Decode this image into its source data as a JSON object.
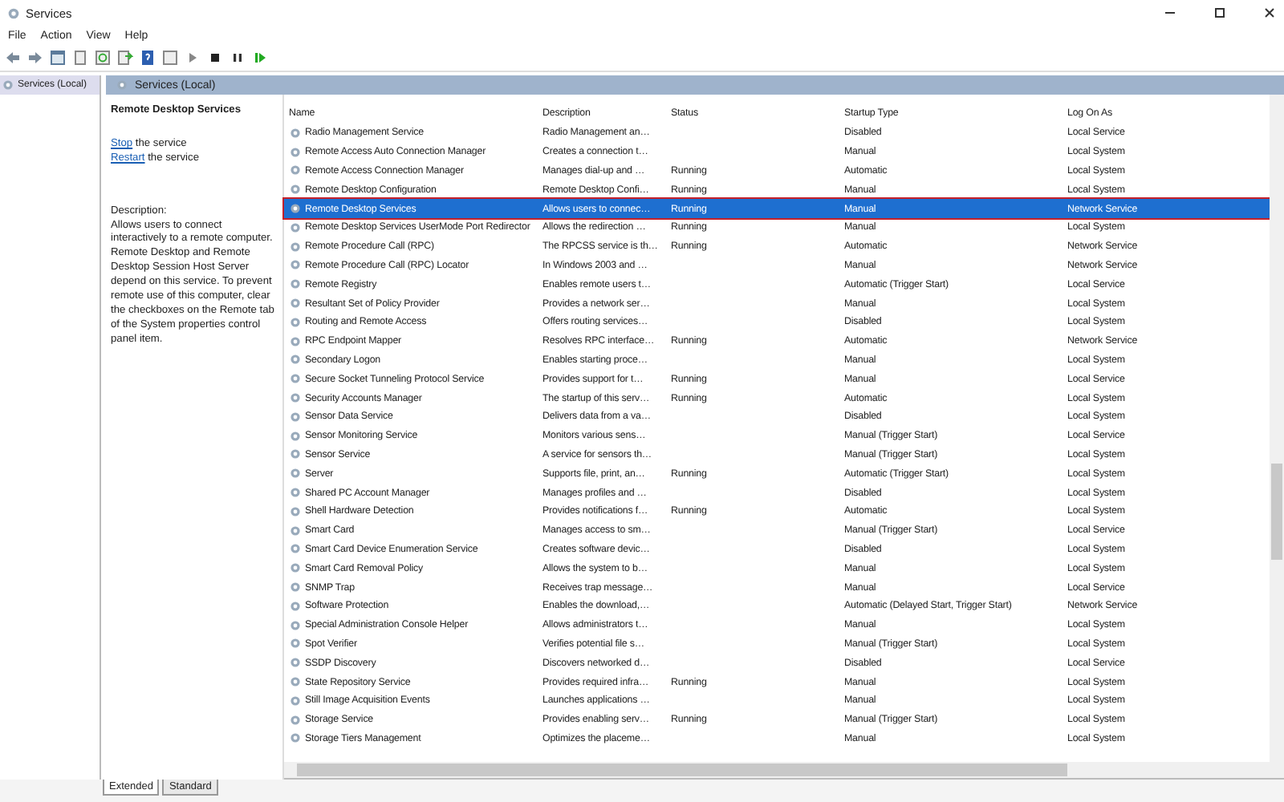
{
  "window": {
    "title": "Services"
  },
  "menu": [
    "File",
    "Action",
    "View",
    "Help"
  ],
  "tree": {
    "items": [
      {
        "label": "Services (Local)",
        "selected": true
      }
    ]
  },
  "pane": {
    "title": "Services (Local)"
  },
  "details": {
    "title": "Remote Desktop Services",
    "actions": [
      {
        "link": "Stop",
        "text": " the service"
      },
      {
        "link": "Restart",
        "text": " the service"
      }
    ],
    "description_label": "Description:",
    "description": "Allows users to connect interactively to a remote computer. Remote Desktop and Remote Desktop Session Host Server depend on this service. To prevent remote use of this computer, clear the checkboxes on the Remote tab of the System properties control panel item."
  },
  "table": {
    "columns": [
      "Name",
      "Description",
      "Status",
      "Startup Type",
      "Log On As"
    ],
    "rows": [
      {
        "name": "Radio Management Service",
        "description": "Radio Management an…",
        "status": "",
        "startup": "Disabled",
        "logon": "Local Service",
        "selected": false
      },
      {
        "name": "Remote Access Auto Connection Manager",
        "description": "Creates a connection t…",
        "status": "",
        "startup": "Manual",
        "logon": "Local System",
        "selected": false
      },
      {
        "name": "Remote Access Connection Manager",
        "description": "Manages dial-up and …",
        "status": "Running",
        "startup": "Automatic",
        "logon": "Local System",
        "selected": false
      },
      {
        "name": "Remote Desktop Configuration",
        "description": "Remote Desktop Confi…",
        "status": "Running",
        "startup": "Manual",
        "logon": "Local System",
        "selected": false
      },
      {
        "name": "Remote Desktop Services",
        "description": "Allows users to connec…",
        "status": "Running",
        "startup": "Manual",
        "logon": "Network Service",
        "selected": true
      },
      {
        "name": "Remote Desktop Services UserMode Port Redirector",
        "description": "Allows the redirection …",
        "status": "Running",
        "startup": "Manual",
        "logon": "Local System",
        "selected": false
      },
      {
        "name": "Remote Procedure Call (RPC)",
        "description": "The RPCSS service is th…",
        "status": "Running",
        "startup": "Automatic",
        "logon": "Network Service",
        "selected": false
      },
      {
        "name": "Remote Procedure Call (RPC) Locator",
        "description": "In Windows 2003 and …",
        "status": "",
        "startup": "Manual",
        "logon": "Network Service",
        "selected": false
      },
      {
        "name": "Remote Registry",
        "description": "Enables remote users t…",
        "status": "",
        "startup": "Automatic (Trigger Start)",
        "logon": "Local Service",
        "selected": false
      },
      {
        "name": "Resultant Set of Policy Provider",
        "description": "Provides a network ser…",
        "status": "",
        "startup": "Manual",
        "logon": "Local System",
        "selected": false
      },
      {
        "name": "Routing and Remote Access",
        "description": "Offers routing services…",
        "status": "",
        "startup": "Disabled",
        "logon": "Local System",
        "selected": false
      },
      {
        "name": "RPC Endpoint Mapper",
        "description": "Resolves RPC interface…",
        "status": "Running",
        "startup": "Automatic",
        "logon": "Network Service",
        "selected": false
      },
      {
        "name": "Secondary Logon",
        "description": "Enables starting proce…",
        "status": "",
        "startup": "Manual",
        "logon": "Local System",
        "selected": false
      },
      {
        "name": "Secure Socket Tunneling Protocol Service",
        "description": "Provides support for t…",
        "status": "Running",
        "startup": "Manual",
        "logon": "Local Service",
        "selected": false
      },
      {
        "name": "Security Accounts Manager",
        "description": "The startup of this serv…",
        "status": "Running",
        "startup": "Automatic",
        "logon": "Local System",
        "selected": false
      },
      {
        "name": "Sensor Data Service",
        "description": "Delivers data from a va…",
        "status": "",
        "startup": "Disabled",
        "logon": "Local System",
        "selected": false
      },
      {
        "name": "Sensor Monitoring Service",
        "description": "Monitors various sens…",
        "status": "",
        "startup": "Manual (Trigger Start)",
        "logon": "Local Service",
        "selected": false
      },
      {
        "name": "Sensor Service",
        "description": "A service for sensors th…",
        "status": "",
        "startup": "Manual (Trigger Start)",
        "logon": "Local System",
        "selected": false
      },
      {
        "name": "Server",
        "description": "Supports file, print, an…",
        "status": "Running",
        "startup": "Automatic (Trigger Start)",
        "logon": "Local System",
        "selected": false
      },
      {
        "name": "Shared PC Account Manager",
        "description": "Manages profiles and …",
        "status": "",
        "startup": "Disabled",
        "logon": "Local System",
        "selected": false
      },
      {
        "name": "Shell Hardware Detection",
        "description": "Provides notifications f…",
        "status": "Running",
        "startup": "Automatic",
        "logon": "Local System",
        "selected": false
      },
      {
        "name": "Smart Card",
        "description": "Manages access to sm…",
        "status": "",
        "startup": "Manual (Trigger Start)",
        "logon": "Local Service",
        "selected": false
      },
      {
        "name": "Smart Card Device Enumeration Service",
        "description": "Creates software devic…",
        "status": "",
        "startup": "Disabled",
        "logon": "Local System",
        "selected": false
      },
      {
        "name": "Smart Card Removal Policy",
        "description": "Allows the system to b…",
        "status": "",
        "startup": "Manual",
        "logon": "Local System",
        "selected": false
      },
      {
        "name": "SNMP Trap",
        "description": "Receives trap message…",
        "status": "",
        "startup": "Manual",
        "logon": "Local Service",
        "selected": false
      },
      {
        "name": "Software Protection",
        "description": "Enables the download,…",
        "status": "",
        "startup": "Automatic (Delayed Start, Trigger Start)",
        "logon": "Network Service",
        "selected": false
      },
      {
        "name": "Special Administration Console Helper",
        "description": "Allows administrators t…",
        "status": "",
        "startup": "Manual",
        "logon": "Local System",
        "selected": false
      },
      {
        "name": "Spot Verifier",
        "description": "Verifies potential file s…",
        "status": "",
        "startup": "Manual (Trigger Start)",
        "logon": "Local System",
        "selected": false
      },
      {
        "name": "SSDP Discovery",
        "description": "Discovers networked d…",
        "status": "",
        "startup": "Disabled",
        "logon": "Local Service",
        "selected": false
      },
      {
        "name": "State Repository Service",
        "description": "Provides required infra…",
        "status": "Running",
        "startup": "Manual",
        "logon": "Local System",
        "selected": false
      },
      {
        "name": "Still Image Acquisition Events",
        "description": "Launches applications …",
        "status": "",
        "startup": "Manual",
        "logon": "Local System",
        "selected": false
      },
      {
        "name": "Storage Service",
        "description": "Provides enabling serv…",
        "status": "Running",
        "startup": "Manual (Trigger Start)",
        "logon": "Local System",
        "selected": false
      },
      {
        "name": "Storage Tiers Management",
        "description": "Optimizes the placeme…",
        "status": "",
        "startup": "Manual",
        "logon": "Local System",
        "selected": false
      }
    ]
  },
  "tabs": [
    {
      "label": "Extended",
      "selected": true
    },
    {
      "label": "Standard",
      "selected": false
    }
  ]
}
